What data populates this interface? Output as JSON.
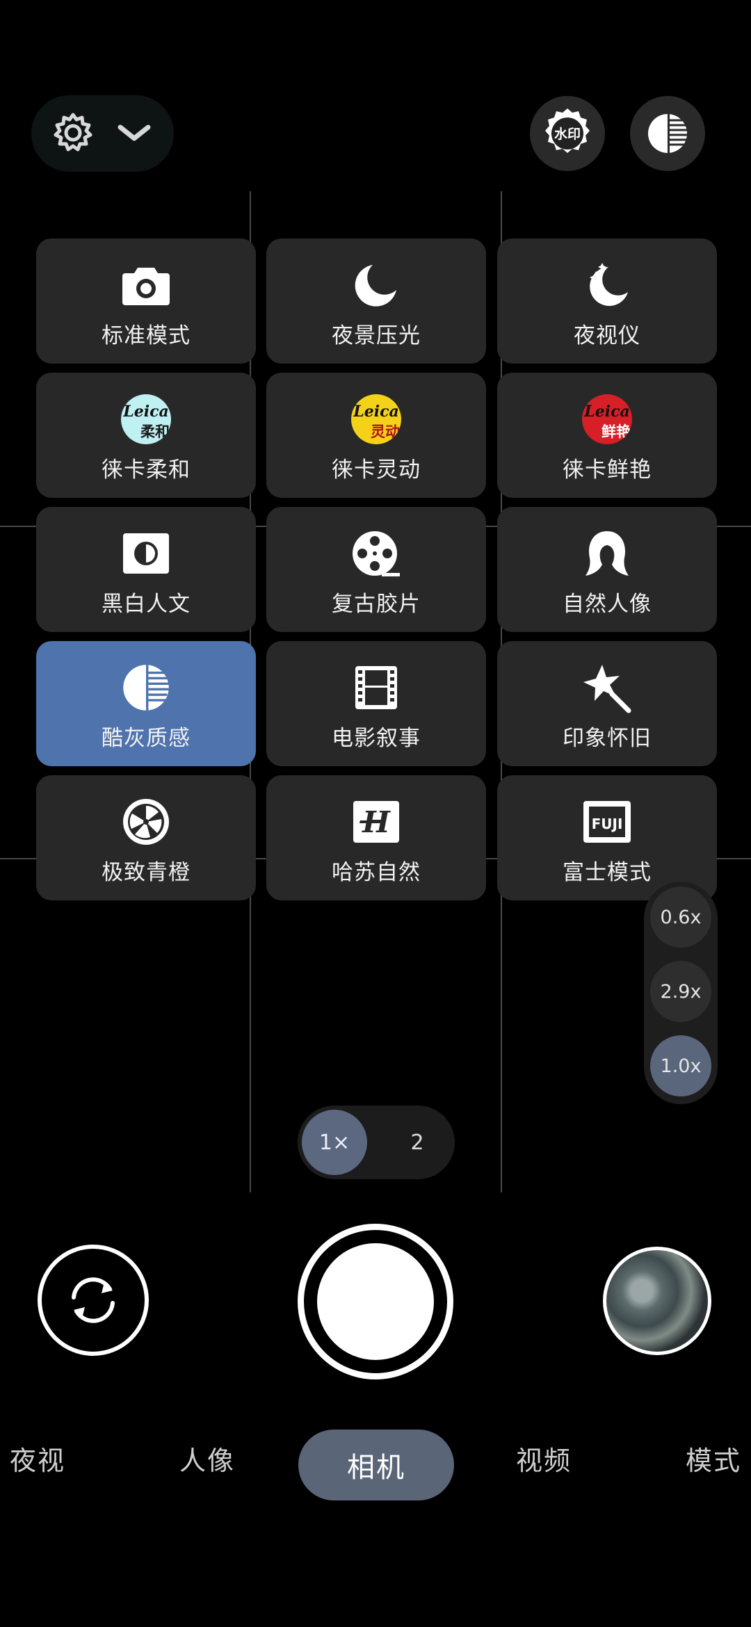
{
  "top_bar": {
    "watermark_label": "水印"
  },
  "filters": [
    {
      "label": "标准模式",
      "icon": "camera-icon"
    },
    {
      "label": "夜景压光",
      "icon": "moon-icon"
    },
    {
      "label": "夜视仪",
      "icon": "moon-sparkle-icon"
    },
    {
      "label": "徕卡柔和",
      "icon": "leica-soft-icon",
      "badge": "Leica",
      "badge_sub": "柔和",
      "color": "#bff0f2",
      "sub_color": "#1a1a1a"
    },
    {
      "label": "徕卡灵动",
      "icon": "leica-vivid-icon",
      "badge": "Leica",
      "badge_sub": "灵动",
      "color": "#f5d21a",
      "sub_color": "#b0101a"
    },
    {
      "label": "徕卡鲜艳",
      "icon": "leica-bright-icon",
      "badge": "Leica",
      "badge_sub": "鲜艳",
      "color": "#d61f26",
      "sub_color": "#ffffff"
    },
    {
      "label": "黑白人文",
      "icon": "bw-icon"
    },
    {
      "label": "复古胶片",
      "icon": "film-reel-icon"
    },
    {
      "label": "自然人像",
      "icon": "portrait-icon"
    },
    {
      "label": "酷灰质感",
      "icon": "half-circle-icon",
      "active": true
    },
    {
      "label": "电影叙事",
      "icon": "film-strip-icon"
    },
    {
      "label": "印象怀旧",
      "icon": "magic-star-icon"
    },
    {
      "label": "极致青橙",
      "icon": "orange-slice-icon"
    },
    {
      "label": "哈苏自然",
      "icon": "hasselblad-icon",
      "glyph": "H"
    },
    {
      "label": "富士模式",
      "icon": "fuji-icon",
      "glyph": "FUJI"
    }
  ],
  "zoom": [
    {
      "label": "0.6x"
    },
    {
      "label": "2.9x"
    },
    {
      "label": "1.0x",
      "selected": true
    }
  ],
  "lens": {
    "primary": "1×",
    "secondary": "2"
  },
  "modes": [
    "夜视",
    "人像",
    "相机",
    "视频",
    "模式"
  ],
  "active_mode": "相机",
  "colors": {
    "active_tile": "#4e73ad",
    "tile": "#282828",
    "mode_pill": "#5a6577"
  }
}
